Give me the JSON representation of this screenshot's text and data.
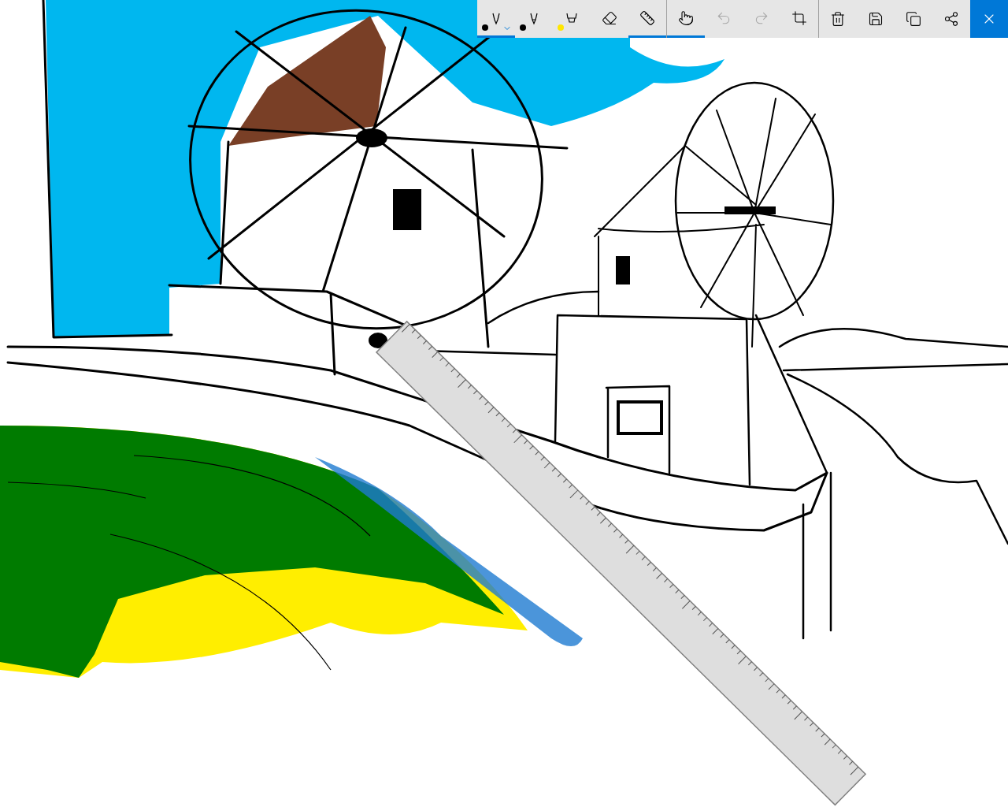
{
  "toolbar": {
    "pens": [
      {
        "kind": "ballpoint",
        "selected": true,
        "color": "#000000"
      },
      {
        "kind": "pencil",
        "selected": false,
        "color": "#000000"
      },
      {
        "kind": "highlighter",
        "selected": false,
        "color": "#ffe600"
      }
    ],
    "tools": [
      {
        "kind": "eraser",
        "on": false
      },
      {
        "kind": "ruler",
        "on": true
      }
    ],
    "input_tools": [
      {
        "kind": "touch-writing",
        "on": true,
        "disabled": false
      },
      {
        "kind": "undo",
        "on": false,
        "disabled": true
      },
      {
        "kind": "redo",
        "on": false,
        "disabled": true
      },
      {
        "kind": "crop",
        "on": false,
        "disabled": false
      }
    ],
    "actions": [
      {
        "kind": "delete"
      },
      {
        "kind": "save"
      },
      {
        "kind": "copy"
      },
      {
        "kind": "share"
      }
    ]
  }
}
